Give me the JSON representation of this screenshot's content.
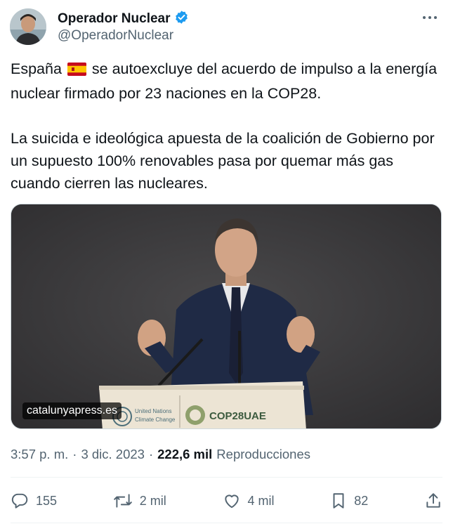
{
  "author": {
    "display_name": "Operador Nuclear",
    "handle": "@OperadorNuclear",
    "verified": true,
    "verified_color": "#1d9bf0"
  },
  "tweet": {
    "line1_pre": "España",
    "line1_post": "se autoexcluye del acuerdo de impulso a la energía nuclear firmado por 23 naciones en la COP28.",
    "paragraph2": "La suicida e ideológica apuesta de la coalición de Gobierno por un supuesto 100% renovables pasa por quemar más gas cuando cierren las nucleares."
  },
  "media": {
    "watermark": "catalunyapress.es",
    "podium_un_line1": "United Nations",
    "podium_un_line2": "Climate Change",
    "podium_cop": "COP28UAE"
  },
  "meta": {
    "time": "3:57 p. m.",
    "separator": "·",
    "date": "3 dic. 2023",
    "views_count": "222,6 mil",
    "views_label": "Reproducciones"
  },
  "actions": {
    "replies": "155",
    "reposts": "2 mil",
    "likes": "4 mil",
    "bookmarks": "82"
  },
  "icons": [
    "more-icon",
    "verified-badge-icon",
    "spain-flag-icon",
    "reply-icon",
    "repost-icon",
    "like-icon",
    "bookmark-icon",
    "share-icon"
  ]
}
